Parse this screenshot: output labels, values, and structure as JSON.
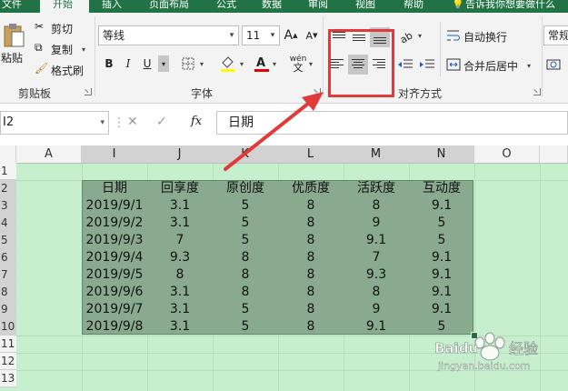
{
  "tabs": [
    "文件",
    "开始",
    "插入",
    "页面布局",
    "公式",
    "数据",
    "审阅",
    "视图",
    "帮助",
    "告诉我你想要做什么"
  ],
  "active_tab": "开始",
  "clipboard": {
    "paste_label": "粘贴",
    "cut_label": "剪切",
    "copy_label": "复制",
    "format_painter_label": "格式刷",
    "group_label": "剪贴板"
  },
  "font": {
    "font_name": "等线",
    "font_size": "11",
    "bold": "B",
    "italic": "I",
    "underline": "U",
    "grow": "A",
    "shrink": "A",
    "phonetic": "wén",
    "group_label": "字体"
  },
  "alignment": {
    "wrap_text_label": "自动换行",
    "merge_center_label": "合并后居中",
    "group_label": "对齐方式",
    "selected": [
      "bottom-align",
      "center-align"
    ]
  },
  "number": {
    "format_value": "常规"
  },
  "formula_bar": {
    "name_box": "I2",
    "fx": "fx",
    "content": "日期"
  },
  "sheet": {
    "columns": [
      "A",
      "I",
      "J",
      "K",
      "L",
      "M",
      "N",
      "O"
    ],
    "rows": [
      "1",
      "2",
      "3",
      "4",
      "5",
      "6",
      "7",
      "8",
      "9",
      "10",
      "11",
      "12",
      "13"
    ],
    "headers": [
      "日期",
      "回享度",
      "原创度",
      "优质度",
      "活跃度",
      "互动度"
    ],
    "data": [
      [
        "2019/9/1",
        "3.1",
        "5",
        "8",
        "8",
        "9.1"
      ],
      [
        "2019/9/2",
        "3.1",
        "5",
        "8",
        "9",
        "5"
      ],
      [
        "2019/9/3",
        "7",
        "5",
        "8",
        "9.1",
        "5"
      ],
      [
        "2019/9/4",
        "9.3",
        "8",
        "8",
        "7",
        "9.1"
      ],
      [
        "2019/9/5",
        "8",
        "8",
        "8",
        "9.3",
        "9.1"
      ],
      [
        "2019/9/6",
        "3.1",
        "8",
        "8",
        "8",
        "9.1"
      ],
      [
        "2019/9/7",
        "3.1",
        "5",
        "8",
        "9",
        "9.1"
      ],
      [
        "2019/9/8",
        "3.1",
        "5",
        "8",
        "9.1",
        "5"
      ]
    ]
  },
  "watermark": {
    "brand": "Baidu",
    "text": "经验",
    "url": "jingyan.baidu.com"
  },
  "colors": {
    "excel_green": "#217346",
    "sheet_fill": "#c6efce",
    "table_fill": "#8aaa8f",
    "annotation_red": "#e23a3a"
  }
}
